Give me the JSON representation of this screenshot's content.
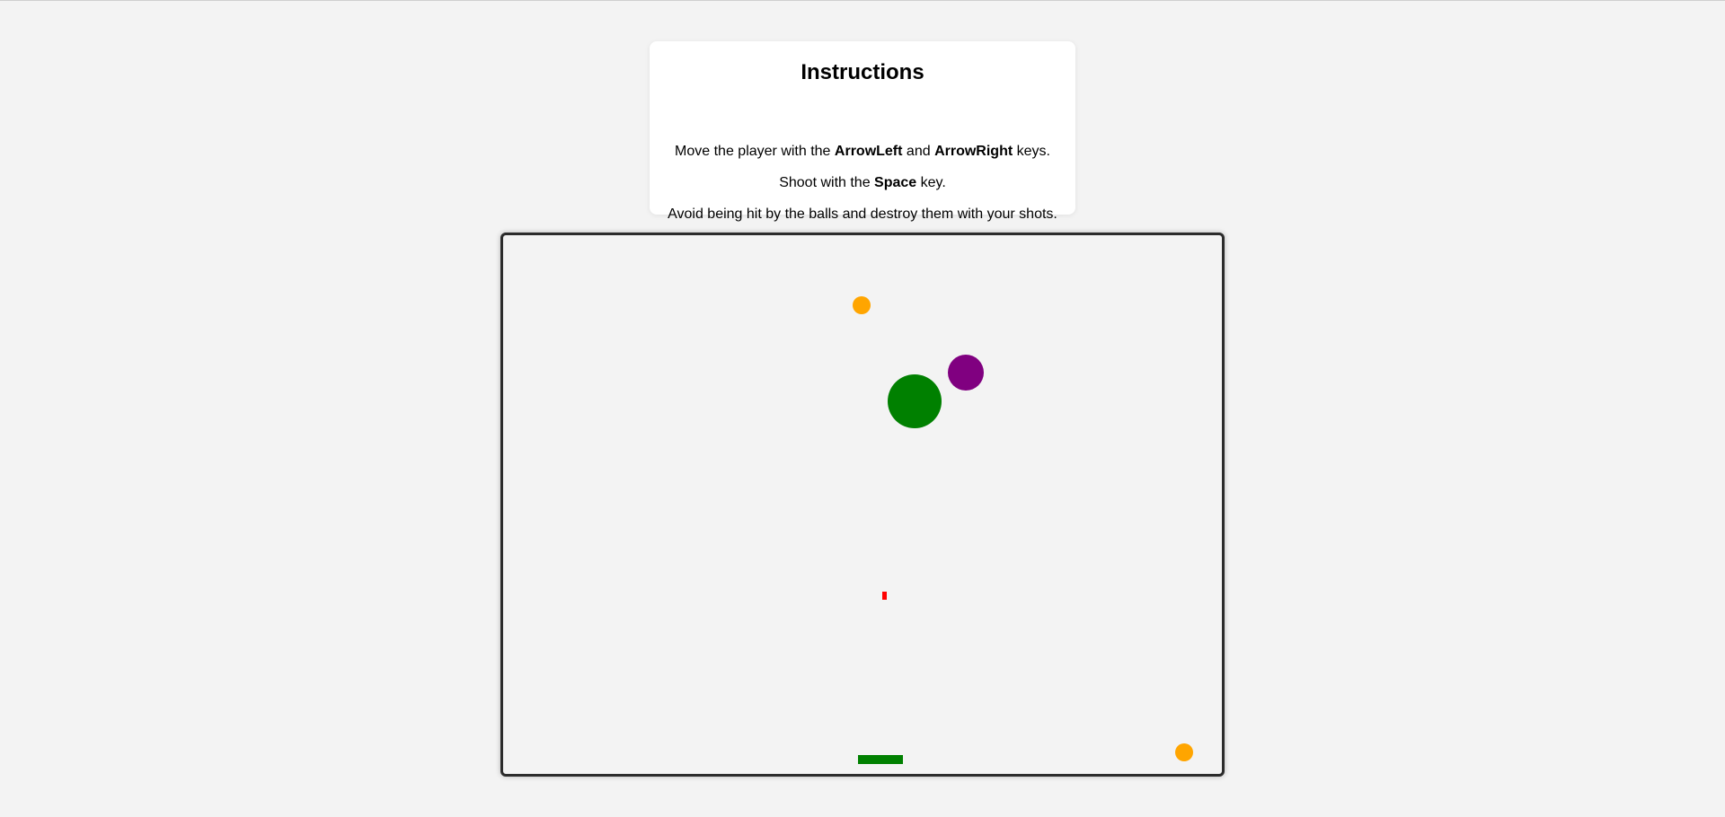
{
  "instructions": {
    "title": "Instructions",
    "line1": {
      "prefix": "Move the player with the ",
      "key_left": "ArrowLeft",
      "middle": " and ",
      "key_right": "ArrowRight",
      "suffix": " keys."
    },
    "line2": {
      "prefix": "Shoot with the ",
      "key_shoot": "Space",
      "suffix": " key."
    },
    "line3": "Avoid being hit by the balls and destroy them with your shots."
  },
  "game": {
    "colors": {
      "background": "#f3f3f3",
      "border": "#2b2b2b",
      "player": "#008000",
      "bullet": "#ff0000",
      "ball_orange": "#ffa500",
      "ball_green": "#008000",
      "ball_purple": "#800080"
    }
  }
}
